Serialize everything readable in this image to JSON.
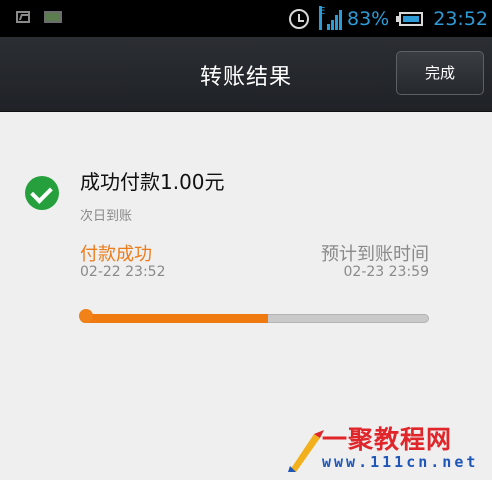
{
  "status_bar": {
    "network_type": "E",
    "battery_percent": "83%",
    "time": "23:52",
    "icons": [
      "picture-icon",
      "book-icon",
      "alarm-icon",
      "signal-icon",
      "battery-icon"
    ]
  },
  "header": {
    "title": "转账结果",
    "done_label": "完成"
  },
  "result": {
    "status_icon": "check-circle-icon",
    "amount_title": "成功付款1.00元",
    "arrival_note": "次日到账",
    "payment": {
      "label": "付款成功",
      "time": "02-22 23:52"
    },
    "expected": {
      "label": "预计到账时间",
      "time": "02-23 23:59"
    },
    "progress_fraction": 0.54
  },
  "colors": {
    "accent": "#ee7a10",
    "success": "#25a03c",
    "status_blue": "#2e9bd6",
    "header_bg": "#25282c"
  },
  "watermark": {
    "brand": "一聚教程网",
    "url": "www.111cn.net"
  }
}
